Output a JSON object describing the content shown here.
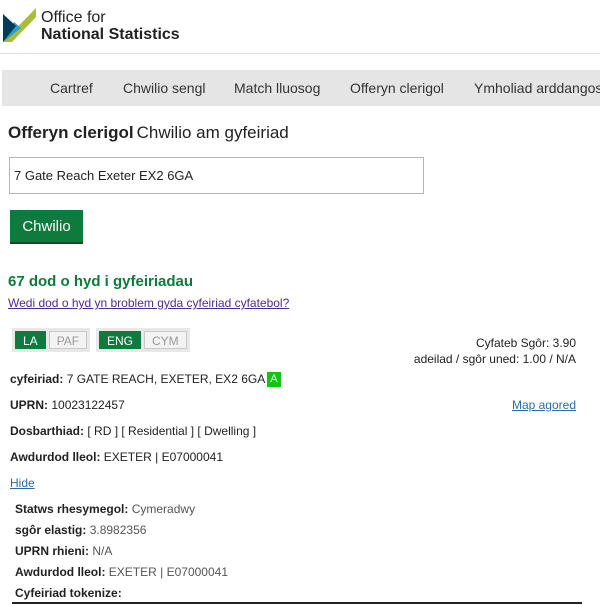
{
  "brand": {
    "line1": "Office for",
    "line2": "National Statistics",
    "colors": [
      "#a8bd3a",
      "#27a0cc",
      "#003c57"
    ]
  },
  "nav": {
    "items": [
      {
        "label": "Cartref"
      },
      {
        "label": "Chwilio sengl"
      },
      {
        "label": "Match lluosog"
      },
      {
        "label": "Offeryn clerigol"
      },
      {
        "label": "Ymholiad arddangos"
      }
    ]
  },
  "page": {
    "title_bold": "Offeryn clerigol",
    "title_sub": "Chwilio am gyfeiriad"
  },
  "search": {
    "value": "7 Gate Reach Exeter EX2 6GA",
    "button_label": "Chwilio"
  },
  "results": {
    "count_text": "67 dod o hyd i gyfeiriadau",
    "problem_link": "Wedi dod o hyd yn broblem gyda cyfeiriad cyfatebol?"
  },
  "result": {
    "tags_source": [
      {
        "label": "LA",
        "active": true
      },
      {
        "label": "PAF",
        "active": false
      }
    ],
    "tags_lang": [
      {
        "label": "ENG",
        "active": true
      },
      {
        "label": "CYM",
        "active": false
      }
    ],
    "score_text": "Cyfateb Sgôr: 3.90",
    "building_score_text": "adeilad / sgôr uned: 1.00 / N/A",
    "address_label": "cyfeiriad:",
    "address_value": "7 GATE REACH, EXETER, EX2 6GA",
    "address_badge": "A",
    "uprn_label": "UPRN:",
    "uprn_value": "10023122457",
    "map_link": "Map agored",
    "classification_label": "Dosbarthiad:",
    "classification_value": "[ RD ] [ Residential ] [ Dwelling ]",
    "authority_label": "Awdurdod lleol:",
    "authority_value": "EXETER | E07000041",
    "hide_link": "Hide",
    "details": {
      "logical_status_label": "Statws rhesymegol:",
      "logical_status_value": "Cymeradwy",
      "elastic_score_label": "sgôr elastig:",
      "elastic_score_value": "3.8982356",
      "parent_uprn_label": "UPRN rhieni:",
      "parent_uprn_value": "N/A",
      "authority_label": "Awdurdod lleol:",
      "authority_value": "EXETER | E07000041",
      "tokenized_label": "Cyfeiriad tokenize:"
    }
  }
}
